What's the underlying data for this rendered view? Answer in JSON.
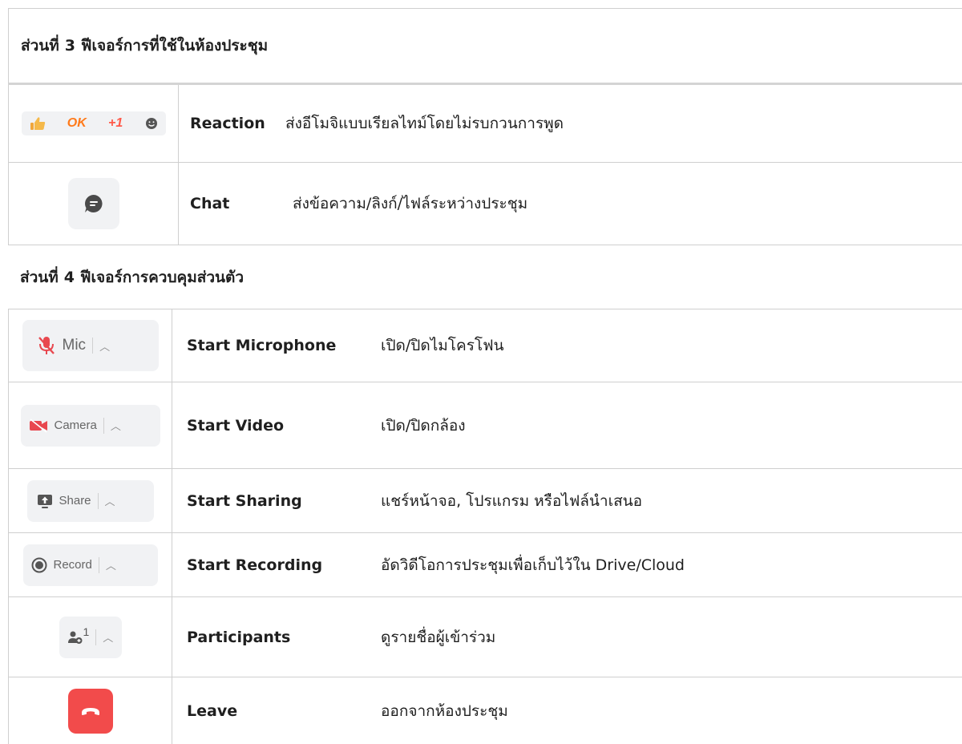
{
  "section3": {
    "prefix": "ส่วนที่",
    "number": "3",
    "title": "ฟีเจอร์การที่ใช้ในห้องประชุม",
    "rows": [
      {
        "name": "Reaction",
        "desc": "ส่งอีโมจิแบบเรียลไทม์โดยไม่รบกวนการพูด",
        "icon": "reaction-toolbar",
        "reaction_ok": "OK",
        "reaction_plus": "+1"
      },
      {
        "name": "Chat",
        "desc": "ส่งข้อความ/ลิงก์/ไฟล์ระหว่างประชุม",
        "icon": "chat-icon"
      }
    ]
  },
  "section4": {
    "prefix": "ส่วนที่",
    "number": "4",
    "title": "ฟีเจอร์การควบคุมส่วนตัว",
    "rows": [
      {
        "name": "Start Microphone",
        "desc": "เปิด/ปิดไมโครโฟน",
        "button_label": "Mic",
        "icon": "mic-off-icon"
      },
      {
        "name": "Start Video",
        "desc": "เปิด/ปิดกล้อง",
        "button_label": "Camera",
        "icon": "camera-off-icon"
      },
      {
        "name": "Start Sharing",
        "desc": "แชร์หน้าจอ, โปรแกรม หรือไฟล์นำเสนอ",
        "button_label": "Share",
        "icon": "share-screen-icon"
      },
      {
        "name": "Start Recording",
        "desc": "อัดวิดีโอการประชุมเพื่อเก็บไว้ใน Drive/Cloud",
        "button_label": "Record",
        "icon": "record-icon"
      },
      {
        "name": "Participants",
        "desc": "ดูรายชื่อผู้เข้าร่วม",
        "button_label": "1",
        "icon": "participants-icon"
      },
      {
        "name": "Leave",
        "desc": "ออกจากห้องประชุม",
        "icon": "leave-call-icon"
      }
    ]
  },
  "colors": {
    "leave_red": "#f24b4b",
    "ok_orange": "#ff7a1a",
    "plus_red": "#ff5a4a",
    "mic_off_red": "#e8484f",
    "camera_off_red": "#e8484f"
  }
}
